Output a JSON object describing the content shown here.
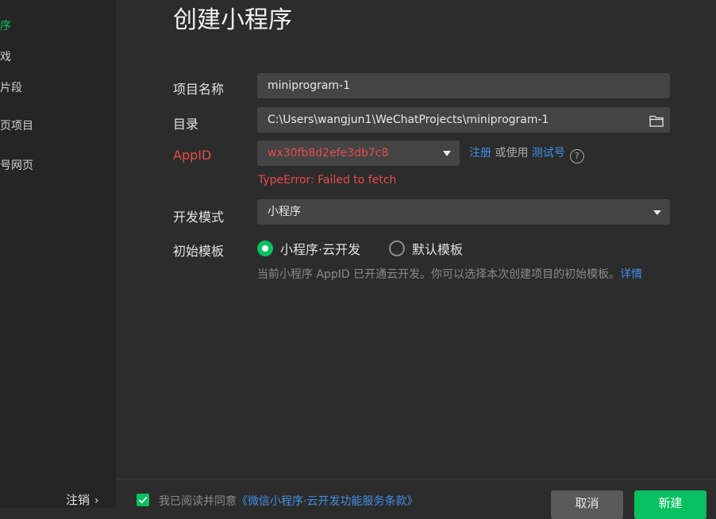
{
  "sidebar": {
    "items": [
      {
        "label": "序",
        "active": true
      },
      {
        "label": "戏",
        "active": false
      },
      {
        "label": "片段",
        "active": false
      },
      {
        "label": "页项目",
        "active": false
      },
      {
        "label": "号网页",
        "active": false
      }
    ],
    "logout_label": "注销",
    "logout_chevron": "›"
  },
  "page": {
    "title": "创建小程序"
  },
  "form": {
    "project_name_label": "项目名称",
    "project_name_value": "miniprogram-1",
    "directory_label": "目录",
    "directory_value": "C:\\Users\\wangjun1\\WeChatProjects\\miniprogram-1",
    "directory_icon": "folder-icon",
    "appid_label": "AppID",
    "appid_value": "wx30fb8d2efe3db7c8",
    "appid_register": "注册",
    "appid_or_use": "或使用",
    "appid_test": "测试号",
    "appid_help": "?",
    "appid_error": "TypeError: Failed to fetch",
    "dev_mode_label": "开发模式",
    "dev_mode_value": "小程序",
    "template_label": "初始模板",
    "template_options": [
      {
        "label": "小程序·云开发",
        "checked": true
      },
      {
        "label": "默认模板",
        "checked": false
      }
    ],
    "hint_text": "当前小程序 AppID 已开通云开发。你可以选择本次创建项目的初始模板。",
    "hint_link": "详情"
  },
  "footer": {
    "agree_checked": true,
    "agree_text": "我已阅读并同意",
    "agree_link": "《微信小程序·云开发功能服务条款》",
    "cancel_label": "取消",
    "create_label": "新建"
  },
  "colors": {
    "accent": "#07c160",
    "link": "#3f8ee8",
    "error": "#e94a4a",
    "background": "#2c2c2c",
    "sidebar_bg": "#252525",
    "field_bg": "#444444"
  }
}
